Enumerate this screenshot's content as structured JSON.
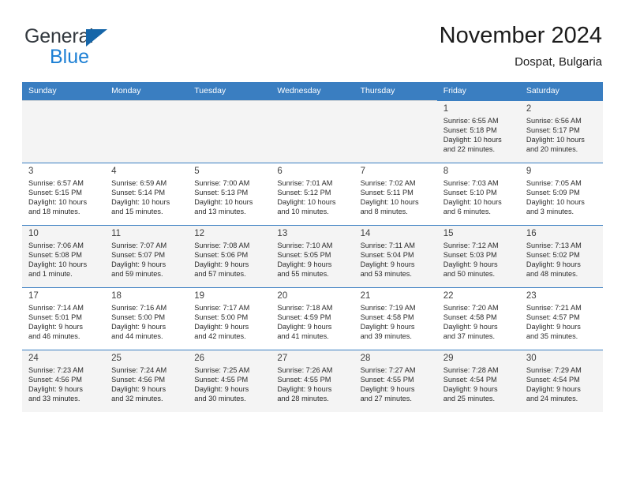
{
  "brand": {
    "name_top": "General",
    "name_bottom": "Blue",
    "triangle_color": "#1565a8",
    "blue_color": "#1c7fd4"
  },
  "header": {
    "title": "November 2024",
    "subtitle": "Dospat, Bulgaria"
  },
  "theme": {
    "header_row_bg": "#3a7ec1",
    "header_row_text": "#ffffff",
    "shaded_row_bg": "#f4f4f4",
    "cell_border": "#3a7ec1"
  },
  "weekdays": [
    "Sunday",
    "Monday",
    "Tuesday",
    "Wednesday",
    "Thursday",
    "Friday",
    "Saturday"
  ],
  "weeks": [
    [
      {
        "empty": true
      },
      {
        "empty": true
      },
      {
        "empty": true
      },
      {
        "empty": true
      },
      {
        "empty": true
      },
      {
        "day": "1",
        "sunrise": "Sunrise: 6:55 AM",
        "sunset": "Sunset: 5:18 PM",
        "daylight1": "Daylight: 10 hours",
        "daylight2": "and 22 minutes."
      },
      {
        "day": "2",
        "sunrise": "Sunrise: 6:56 AM",
        "sunset": "Sunset: 5:17 PM",
        "daylight1": "Daylight: 10 hours",
        "daylight2": "and 20 minutes."
      }
    ],
    [
      {
        "day": "3",
        "sunrise": "Sunrise: 6:57 AM",
        "sunset": "Sunset: 5:15 PM",
        "daylight1": "Daylight: 10 hours",
        "daylight2": "and 18 minutes."
      },
      {
        "day": "4",
        "sunrise": "Sunrise: 6:59 AM",
        "sunset": "Sunset: 5:14 PM",
        "daylight1": "Daylight: 10 hours",
        "daylight2": "and 15 minutes."
      },
      {
        "day": "5",
        "sunrise": "Sunrise: 7:00 AM",
        "sunset": "Sunset: 5:13 PM",
        "daylight1": "Daylight: 10 hours",
        "daylight2": "and 13 minutes."
      },
      {
        "day": "6",
        "sunrise": "Sunrise: 7:01 AM",
        "sunset": "Sunset: 5:12 PM",
        "daylight1": "Daylight: 10 hours",
        "daylight2": "and 10 minutes."
      },
      {
        "day": "7",
        "sunrise": "Sunrise: 7:02 AM",
        "sunset": "Sunset: 5:11 PM",
        "daylight1": "Daylight: 10 hours",
        "daylight2": "and 8 minutes."
      },
      {
        "day": "8",
        "sunrise": "Sunrise: 7:03 AM",
        "sunset": "Sunset: 5:10 PM",
        "daylight1": "Daylight: 10 hours",
        "daylight2": "and 6 minutes."
      },
      {
        "day": "9",
        "sunrise": "Sunrise: 7:05 AM",
        "sunset": "Sunset: 5:09 PM",
        "daylight1": "Daylight: 10 hours",
        "daylight2": "and 3 minutes."
      }
    ],
    [
      {
        "day": "10",
        "sunrise": "Sunrise: 7:06 AM",
        "sunset": "Sunset: 5:08 PM",
        "daylight1": "Daylight: 10 hours",
        "daylight2": "and 1 minute."
      },
      {
        "day": "11",
        "sunrise": "Sunrise: 7:07 AM",
        "sunset": "Sunset: 5:07 PM",
        "daylight1": "Daylight: 9 hours",
        "daylight2": "and 59 minutes."
      },
      {
        "day": "12",
        "sunrise": "Sunrise: 7:08 AM",
        "sunset": "Sunset: 5:06 PM",
        "daylight1": "Daylight: 9 hours",
        "daylight2": "and 57 minutes."
      },
      {
        "day": "13",
        "sunrise": "Sunrise: 7:10 AM",
        "sunset": "Sunset: 5:05 PM",
        "daylight1": "Daylight: 9 hours",
        "daylight2": "and 55 minutes."
      },
      {
        "day": "14",
        "sunrise": "Sunrise: 7:11 AM",
        "sunset": "Sunset: 5:04 PM",
        "daylight1": "Daylight: 9 hours",
        "daylight2": "and 53 minutes."
      },
      {
        "day": "15",
        "sunrise": "Sunrise: 7:12 AM",
        "sunset": "Sunset: 5:03 PM",
        "daylight1": "Daylight: 9 hours",
        "daylight2": "and 50 minutes."
      },
      {
        "day": "16",
        "sunrise": "Sunrise: 7:13 AM",
        "sunset": "Sunset: 5:02 PM",
        "daylight1": "Daylight: 9 hours",
        "daylight2": "and 48 minutes."
      }
    ],
    [
      {
        "day": "17",
        "sunrise": "Sunrise: 7:14 AM",
        "sunset": "Sunset: 5:01 PM",
        "daylight1": "Daylight: 9 hours",
        "daylight2": "and 46 minutes."
      },
      {
        "day": "18",
        "sunrise": "Sunrise: 7:16 AM",
        "sunset": "Sunset: 5:00 PM",
        "daylight1": "Daylight: 9 hours",
        "daylight2": "and 44 minutes."
      },
      {
        "day": "19",
        "sunrise": "Sunrise: 7:17 AM",
        "sunset": "Sunset: 5:00 PM",
        "daylight1": "Daylight: 9 hours",
        "daylight2": "and 42 minutes."
      },
      {
        "day": "20",
        "sunrise": "Sunrise: 7:18 AM",
        "sunset": "Sunset: 4:59 PM",
        "daylight1": "Daylight: 9 hours",
        "daylight2": "and 41 minutes."
      },
      {
        "day": "21",
        "sunrise": "Sunrise: 7:19 AM",
        "sunset": "Sunset: 4:58 PM",
        "daylight1": "Daylight: 9 hours",
        "daylight2": "and 39 minutes."
      },
      {
        "day": "22",
        "sunrise": "Sunrise: 7:20 AM",
        "sunset": "Sunset: 4:58 PM",
        "daylight1": "Daylight: 9 hours",
        "daylight2": "and 37 minutes."
      },
      {
        "day": "23",
        "sunrise": "Sunrise: 7:21 AM",
        "sunset": "Sunset: 4:57 PM",
        "daylight1": "Daylight: 9 hours",
        "daylight2": "and 35 minutes."
      }
    ],
    [
      {
        "day": "24",
        "sunrise": "Sunrise: 7:23 AM",
        "sunset": "Sunset: 4:56 PM",
        "daylight1": "Daylight: 9 hours",
        "daylight2": "and 33 minutes."
      },
      {
        "day": "25",
        "sunrise": "Sunrise: 7:24 AM",
        "sunset": "Sunset: 4:56 PM",
        "daylight1": "Daylight: 9 hours",
        "daylight2": "and 32 minutes."
      },
      {
        "day": "26",
        "sunrise": "Sunrise: 7:25 AM",
        "sunset": "Sunset: 4:55 PM",
        "daylight1": "Daylight: 9 hours",
        "daylight2": "and 30 minutes."
      },
      {
        "day": "27",
        "sunrise": "Sunrise: 7:26 AM",
        "sunset": "Sunset: 4:55 PM",
        "daylight1": "Daylight: 9 hours",
        "daylight2": "and 28 minutes."
      },
      {
        "day": "28",
        "sunrise": "Sunrise: 7:27 AM",
        "sunset": "Sunset: 4:55 PM",
        "daylight1": "Daylight: 9 hours",
        "daylight2": "and 27 minutes."
      },
      {
        "day": "29",
        "sunrise": "Sunrise: 7:28 AM",
        "sunset": "Sunset: 4:54 PM",
        "daylight1": "Daylight: 9 hours",
        "daylight2": "and 25 minutes."
      },
      {
        "day": "30",
        "sunrise": "Sunrise: 7:29 AM",
        "sunset": "Sunset: 4:54 PM",
        "daylight1": "Daylight: 9 hours",
        "daylight2": "and 24 minutes."
      }
    ]
  ]
}
